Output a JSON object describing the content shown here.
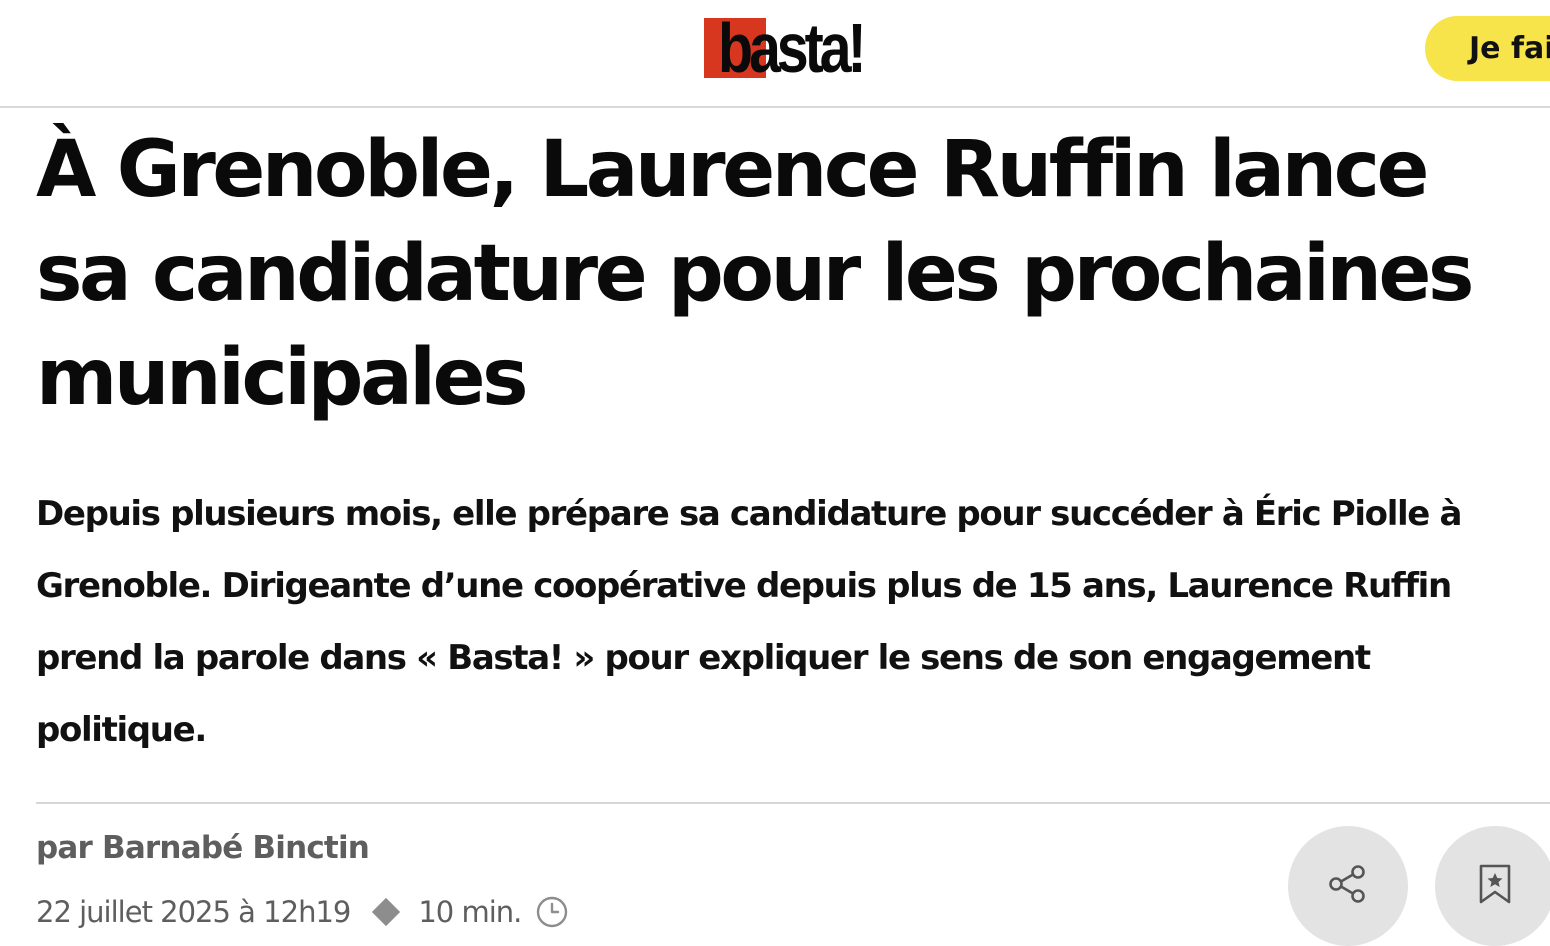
{
  "header": {
    "logo_text": "basta!",
    "donate_label": "Je fai",
    "brand_red": "#d7361f",
    "donate_color": "#f7e34a"
  },
  "article": {
    "title": "À Grenoble, Laurence Ruffin lance sa candidature pour les prochaines municipales",
    "lede": "Depuis plusieurs mois, elle prépare sa candidature pour succéder à Éric Piolle à Grenoble. Dirigeante d’une coopérative depuis plus de 15 ans, Laurence Ruffin prend la parole dans « Basta! » pour expliquer le sens de son engagement politique.",
    "byline": "par Barnabé Binctin",
    "date": "22 juillet 2025 à 12h19",
    "read_time": "10 min."
  },
  "actions": {
    "share_icon": "share-icon",
    "bookmark_icon": "bookmark-star-icon",
    "clock_icon": "clock-icon"
  }
}
